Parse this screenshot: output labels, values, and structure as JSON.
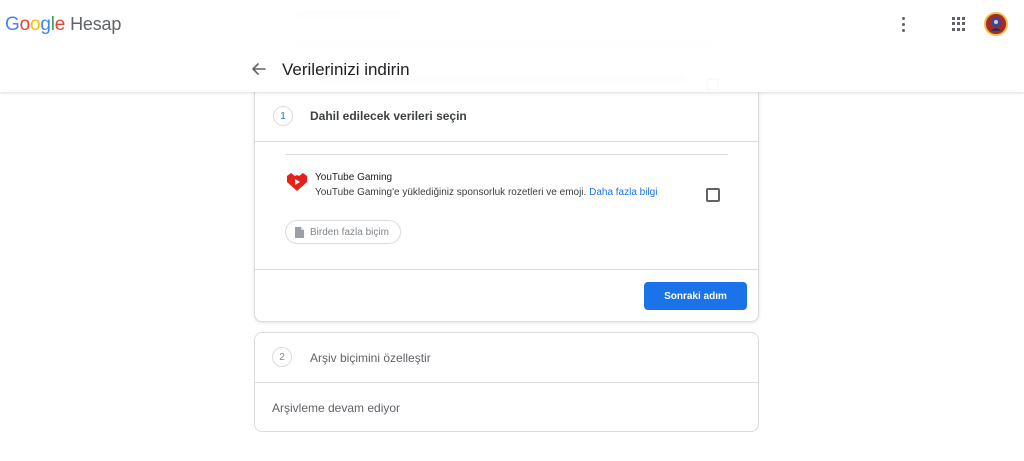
{
  "header": {
    "logo_parts": [
      "G",
      "o",
      "o",
      "g",
      "l",
      "e"
    ],
    "product": "Hesap",
    "page_title": "Verilerinizi indirin"
  },
  "icons": {
    "more": "more-vert-icon",
    "apps": "apps-grid-icon",
    "back": "arrow-back-icon",
    "service": "youtube-gaming-icon",
    "file": "file-icon"
  },
  "step1": {
    "number": "1",
    "title": "Dahil edilecek verileri seçin"
  },
  "service_item": {
    "name": "YouTube Gaming",
    "description": "YouTube Gaming'e yüklediğiniz sponsorluk rozetleri ve emoji.",
    "link": "Daha fazla bilgi",
    "checked": false,
    "format_chip": "Birden fazla biçim"
  },
  "actions": {
    "next": "Sonraki adım"
  },
  "step2": {
    "number": "2",
    "title": "Arşiv biçimini özelleştir",
    "status": "Arşivleme devam ediyor"
  },
  "colors": {
    "accent": "#1a73e8",
    "youtube_red": "#e62117"
  }
}
